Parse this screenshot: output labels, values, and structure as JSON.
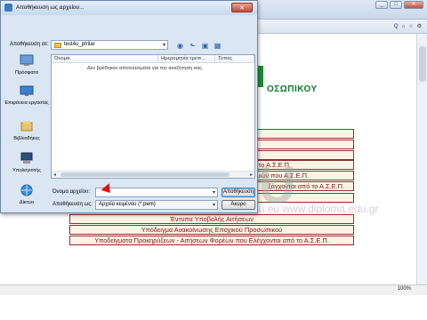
{
  "browser": {
    "window_buttons": [
      "_",
      "□",
      "✕"
    ],
    "toolbar_icons": [
      "home-icon",
      "star-icon",
      "gear-icon"
    ],
    "toolbar_text": "Q",
    "zoom": "100%",
    "heading": "ΟΣΩΠΙΚΟΥ",
    "table_rows": [
      "",
      "",
      "",
      "από το Α.Σ.Ε.Π.",
      "ανισμών που Α.Σ.Ε.Π.",
      "ξάγχονται από το Α.Σ.Ε.Π.",
      "",
      "Έντυπα Υποβολής Αιτήσεων",
      "Υπόδειγμα Ανακοίνωσης Εποχικού Προσωπικού",
      "Υποδείγματα Προκηρύξεων - Αιτήσεων Φορέων που Ελέγχονται από το Α.Σ.Ε.Π."
    ],
    "watermark": "TEST4U",
    "watermark_sub": "DIPLOMA",
    "watermark_url": "www.test4u.eu   www.diploma.edu.gr"
  },
  "dialog": {
    "title": "Αποθήκευση ως αρχείου...",
    "close_label": "✕",
    "save_in_label": "Αποθήκευση σε:",
    "save_in_value": "test4u_ptrilar",
    "places": [
      {
        "label": "Πρόσφατα",
        "icon": "recent-icon"
      },
      {
        "label": "Επιφάνεια εργασίας",
        "icon": "desktop-icon"
      },
      {
        "label": "Βιβλιοθήκες",
        "icon": "libraries-icon"
      },
      {
        "label": "Υπολογιστής",
        "icon": "computer-icon"
      },
      {
        "label": "Δίκτυο",
        "icon": "network-icon"
      }
    ],
    "columns": [
      "Όνομα",
      "Ημερομηνία τροπ...",
      "Τύπος"
    ],
    "empty_message": "Δεν βρέθηκαν αποτελέσματα για την αναζήτηση σας.",
    "filename_label": "Όνομα αρχείου:",
    "filename_value": "",
    "filetype_label": "Αποθήκευση ως:",
    "filetype_value": "Αρχεία κειμένου (*.pem)",
    "save_button": "Αποθήκευση",
    "cancel_button": "Άκυρο"
  }
}
